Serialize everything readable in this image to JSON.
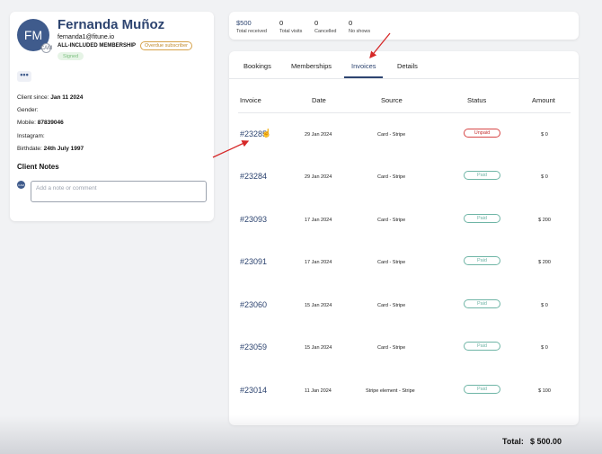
{
  "client": {
    "initials": "FM",
    "name": "Fernanda Muñoz",
    "email": "fernanda1@fitune.io",
    "membership": "ALL-INCLUDED MEMBERSHIP",
    "subscriber_badge": "Overdue subscriber",
    "signed_badge": "Signed",
    "avatar_badge": "CAM",
    "more_label": "•••",
    "details": [
      {
        "label": "Client since:",
        "value": "Jan 11 2024"
      },
      {
        "label": "Gender:",
        "value": ""
      },
      {
        "label": "Mobile:",
        "value": "87839046"
      },
      {
        "label": "Instagram:",
        "value": ""
      },
      {
        "label": "Birthdate:",
        "value": "24th July 1997"
      }
    ],
    "notes_title": "Client Notes",
    "note_avatar": "CAM",
    "note_placeholder": "Add a note or comment"
  },
  "stats": [
    {
      "value": "$500",
      "label": "Total received"
    },
    {
      "value": "0",
      "label": "Total visits"
    },
    {
      "value": "0",
      "label": "Cancelled"
    },
    {
      "value": "0",
      "label": "No shows"
    }
  ],
  "tabs": [
    "Bookings",
    "Memberships",
    "Invoices",
    "Details"
  ],
  "active_tab": "Invoices",
  "table": {
    "headers": [
      "Invoice",
      "Date",
      "Source",
      "Status",
      "Amount"
    ],
    "rows": [
      {
        "id": "#23285",
        "date": "29 Jan 2024",
        "source": "Card - Stripe",
        "status": "Unpaid",
        "amount": "$ 0"
      },
      {
        "id": "#23284",
        "date": "29 Jan 2024",
        "source": "Card - Stripe",
        "status": "Paid",
        "amount": "$ 0"
      },
      {
        "id": "#23093",
        "date": "17 Jan 2024",
        "source": "Card - Stripe",
        "status": "Paid",
        "amount": "$ 200"
      },
      {
        "id": "#23091",
        "date": "17 Jan 2024",
        "source": "Card - Stripe",
        "status": "Paid",
        "amount": "$ 200"
      },
      {
        "id": "#23060",
        "date": "15 Jan 2024",
        "source": "Card - Stripe",
        "status": "Paid",
        "amount": "$ 0"
      },
      {
        "id": "#23059",
        "date": "15 Jan 2024",
        "source": "Card - Stripe",
        "status": "Paid",
        "amount": "$ 0"
      },
      {
        "id": "#23014",
        "date": "11 Jan 2024",
        "source": "Stripe element - Stripe",
        "status": "Paid",
        "amount": "$ 100"
      }
    ]
  },
  "footer": {
    "total_label": "Total:",
    "total_value": "$ 500.00"
  },
  "colors": {
    "accent": "#2d4470",
    "unpaid": "#d64545",
    "paid": "#6fb5a6",
    "annotation": "#d62828"
  }
}
